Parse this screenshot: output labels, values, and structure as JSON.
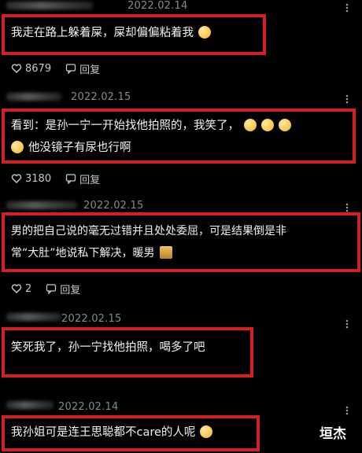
{
  "comments": [
    {
      "date": "2022.02.14",
      "text": "我走在路上躲着屎，屎却偏偏粘着我",
      "likes": "8679",
      "reply_label": "回复"
    },
    {
      "date": "2022.02.15",
      "text_line1": "看到：是孙一宁一开始找他拍照的，我笑了，",
      "text_line2": "他没镜子有尿也行啊",
      "likes": "3180",
      "reply_label": "回复"
    },
    {
      "date": "2022.02.15",
      "text_line1": "男的把自己说的毫无过错并且处处委屈，可是结果倒是非",
      "text_line2": "常“大肚”地说私下解决，暖男",
      "likes": "2",
      "reply_label": "回复"
    },
    {
      "date": "2022.02.15",
      "text": "笑死我了，孙一宁找他拍照，喝多了吧"
    },
    {
      "date": "2022.02.14",
      "text": "我孙姐可是连王思聪都不care的人呢"
    }
  ],
  "watermark": "垣杰",
  "colors": {
    "highlight_border": "#d21f1f",
    "background": "#000000"
  }
}
